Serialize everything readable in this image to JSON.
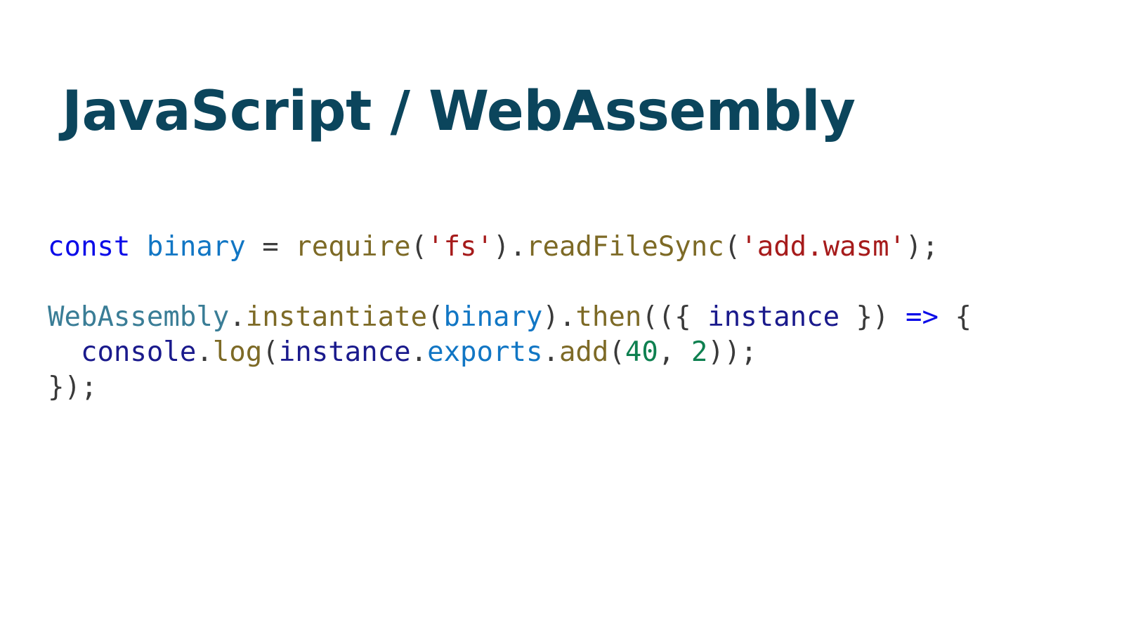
{
  "slide": {
    "title": "JavaScript / WebAssembly",
    "title_color": "#0b455c",
    "background_color": "#ffffff"
  },
  "code": {
    "language": "javascript",
    "full_text": "const binary = require('fs').readFileSync('add.wasm');\n\nWebAssembly.instantiate(binary).then(({ instance }) => {\n  console.log(instance.exports.add(40, 2));\n});",
    "palette": {
      "keyword": "#0c0ce8",
      "variable": "#1176c4",
      "navy_identifier": "#1a1a8c",
      "function": "#7d6a26",
      "string": "#a61b1b",
      "number": "#0e8050",
      "builtin": "#3a7d96",
      "punctuation": "#3a3a3a",
      "operator": "#3e3e3e"
    },
    "lines": [
      {
        "index": 1,
        "text": "const binary = require('fs').readFileSync('add.wasm');",
        "tokens": [
          {
            "t": "const",
            "c": "keyword"
          },
          {
            "t": " ",
            "c": "plain"
          },
          {
            "t": "binary",
            "c": "varblue"
          },
          {
            "t": " ",
            "c": "plain"
          },
          {
            "t": "=",
            "c": "operator"
          },
          {
            "t": " ",
            "c": "plain"
          },
          {
            "t": "require",
            "c": "func"
          },
          {
            "t": "(",
            "c": "punct"
          },
          {
            "t": "'fs'",
            "c": "string"
          },
          {
            "t": ")",
            "c": "punct"
          },
          {
            "t": ".",
            "c": "punct"
          },
          {
            "t": "readFileSync",
            "c": "func"
          },
          {
            "t": "(",
            "c": "punct"
          },
          {
            "t": "'add.wasm'",
            "c": "string"
          },
          {
            "t": ")",
            "c": "punct"
          },
          {
            "t": ";",
            "c": "punct"
          }
        ]
      },
      {
        "index": 2,
        "text": "",
        "tokens": []
      },
      {
        "index": 3,
        "text": "WebAssembly.instantiate(binary).then(({ instance }) => {",
        "tokens": [
          {
            "t": "WebAssembly",
            "c": "builtin"
          },
          {
            "t": ".",
            "c": "punct"
          },
          {
            "t": "instantiate",
            "c": "func"
          },
          {
            "t": "(",
            "c": "punct"
          },
          {
            "t": "binary",
            "c": "varblue"
          },
          {
            "t": ")",
            "c": "punct"
          },
          {
            "t": ".",
            "c": "punct"
          },
          {
            "t": "then",
            "c": "func"
          },
          {
            "t": "(({ ",
            "c": "punct"
          },
          {
            "t": "instance",
            "c": "navy"
          },
          {
            "t": " }) ",
            "c": "punct"
          },
          {
            "t": "=>",
            "c": "arrow"
          },
          {
            "t": " {",
            "c": "punct"
          }
        ]
      },
      {
        "index": 4,
        "text": "  console.log(instance.exports.add(40, 2));",
        "tokens": [
          {
            "t": "  ",
            "c": "plain"
          },
          {
            "t": "console",
            "c": "navy"
          },
          {
            "t": ".",
            "c": "punct"
          },
          {
            "t": "log",
            "c": "func"
          },
          {
            "t": "(",
            "c": "punct"
          },
          {
            "t": "instance",
            "c": "navy"
          },
          {
            "t": ".",
            "c": "punct"
          },
          {
            "t": "exports",
            "c": "propblue"
          },
          {
            "t": ".",
            "c": "punct"
          },
          {
            "t": "add",
            "c": "func"
          },
          {
            "t": "(",
            "c": "punct"
          },
          {
            "t": "40",
            "c": "number"
          },
          {
            "t": ", ",
            "c": "punct"
          },
          {
            "t": "2",
            "c": "number"
          },
          {
            "t": "));",
            "c": "punct"
          }
        ]
      },
      {
        "index": 5,
        "text": "});",
        "tokens": [
          {
            "t": "});",
            "c": "punct"
          }
        ]
      }
    ]
  }
}
